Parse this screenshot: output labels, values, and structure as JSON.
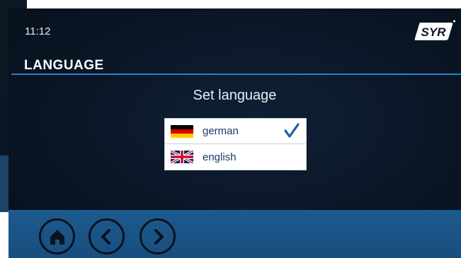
{
  "status": {
    "time": "11:12"
  },
  "brand": {
    "logo_text": "SYR"
  },
  "page": {
    "title": "LANGUAGE",
    "subtitle": "Set language"
  },
  "languages": [
    {
      "label": "german",
      "flag": "germany-flag-icon",
      "selected": true
    },
    {
      "label": "english",
      "flag": "uk-flag-icon",
      "selected": false
    }
  ],
  "nav": [
    {
      "icon": "home-icon"
    },
    {
      "icon": "chevron-left-icon"
    },
    {
      "icon": "chevron-right-icon"
    }
  ],
  "colors": {
    "background": "#0a1626",
    "accent": "#2f7fc0",
    "bottom_bar": "#1d5a8e",
    "check": "#1e5fa8",
    "list_text": "#1b3a66"
  }
}
